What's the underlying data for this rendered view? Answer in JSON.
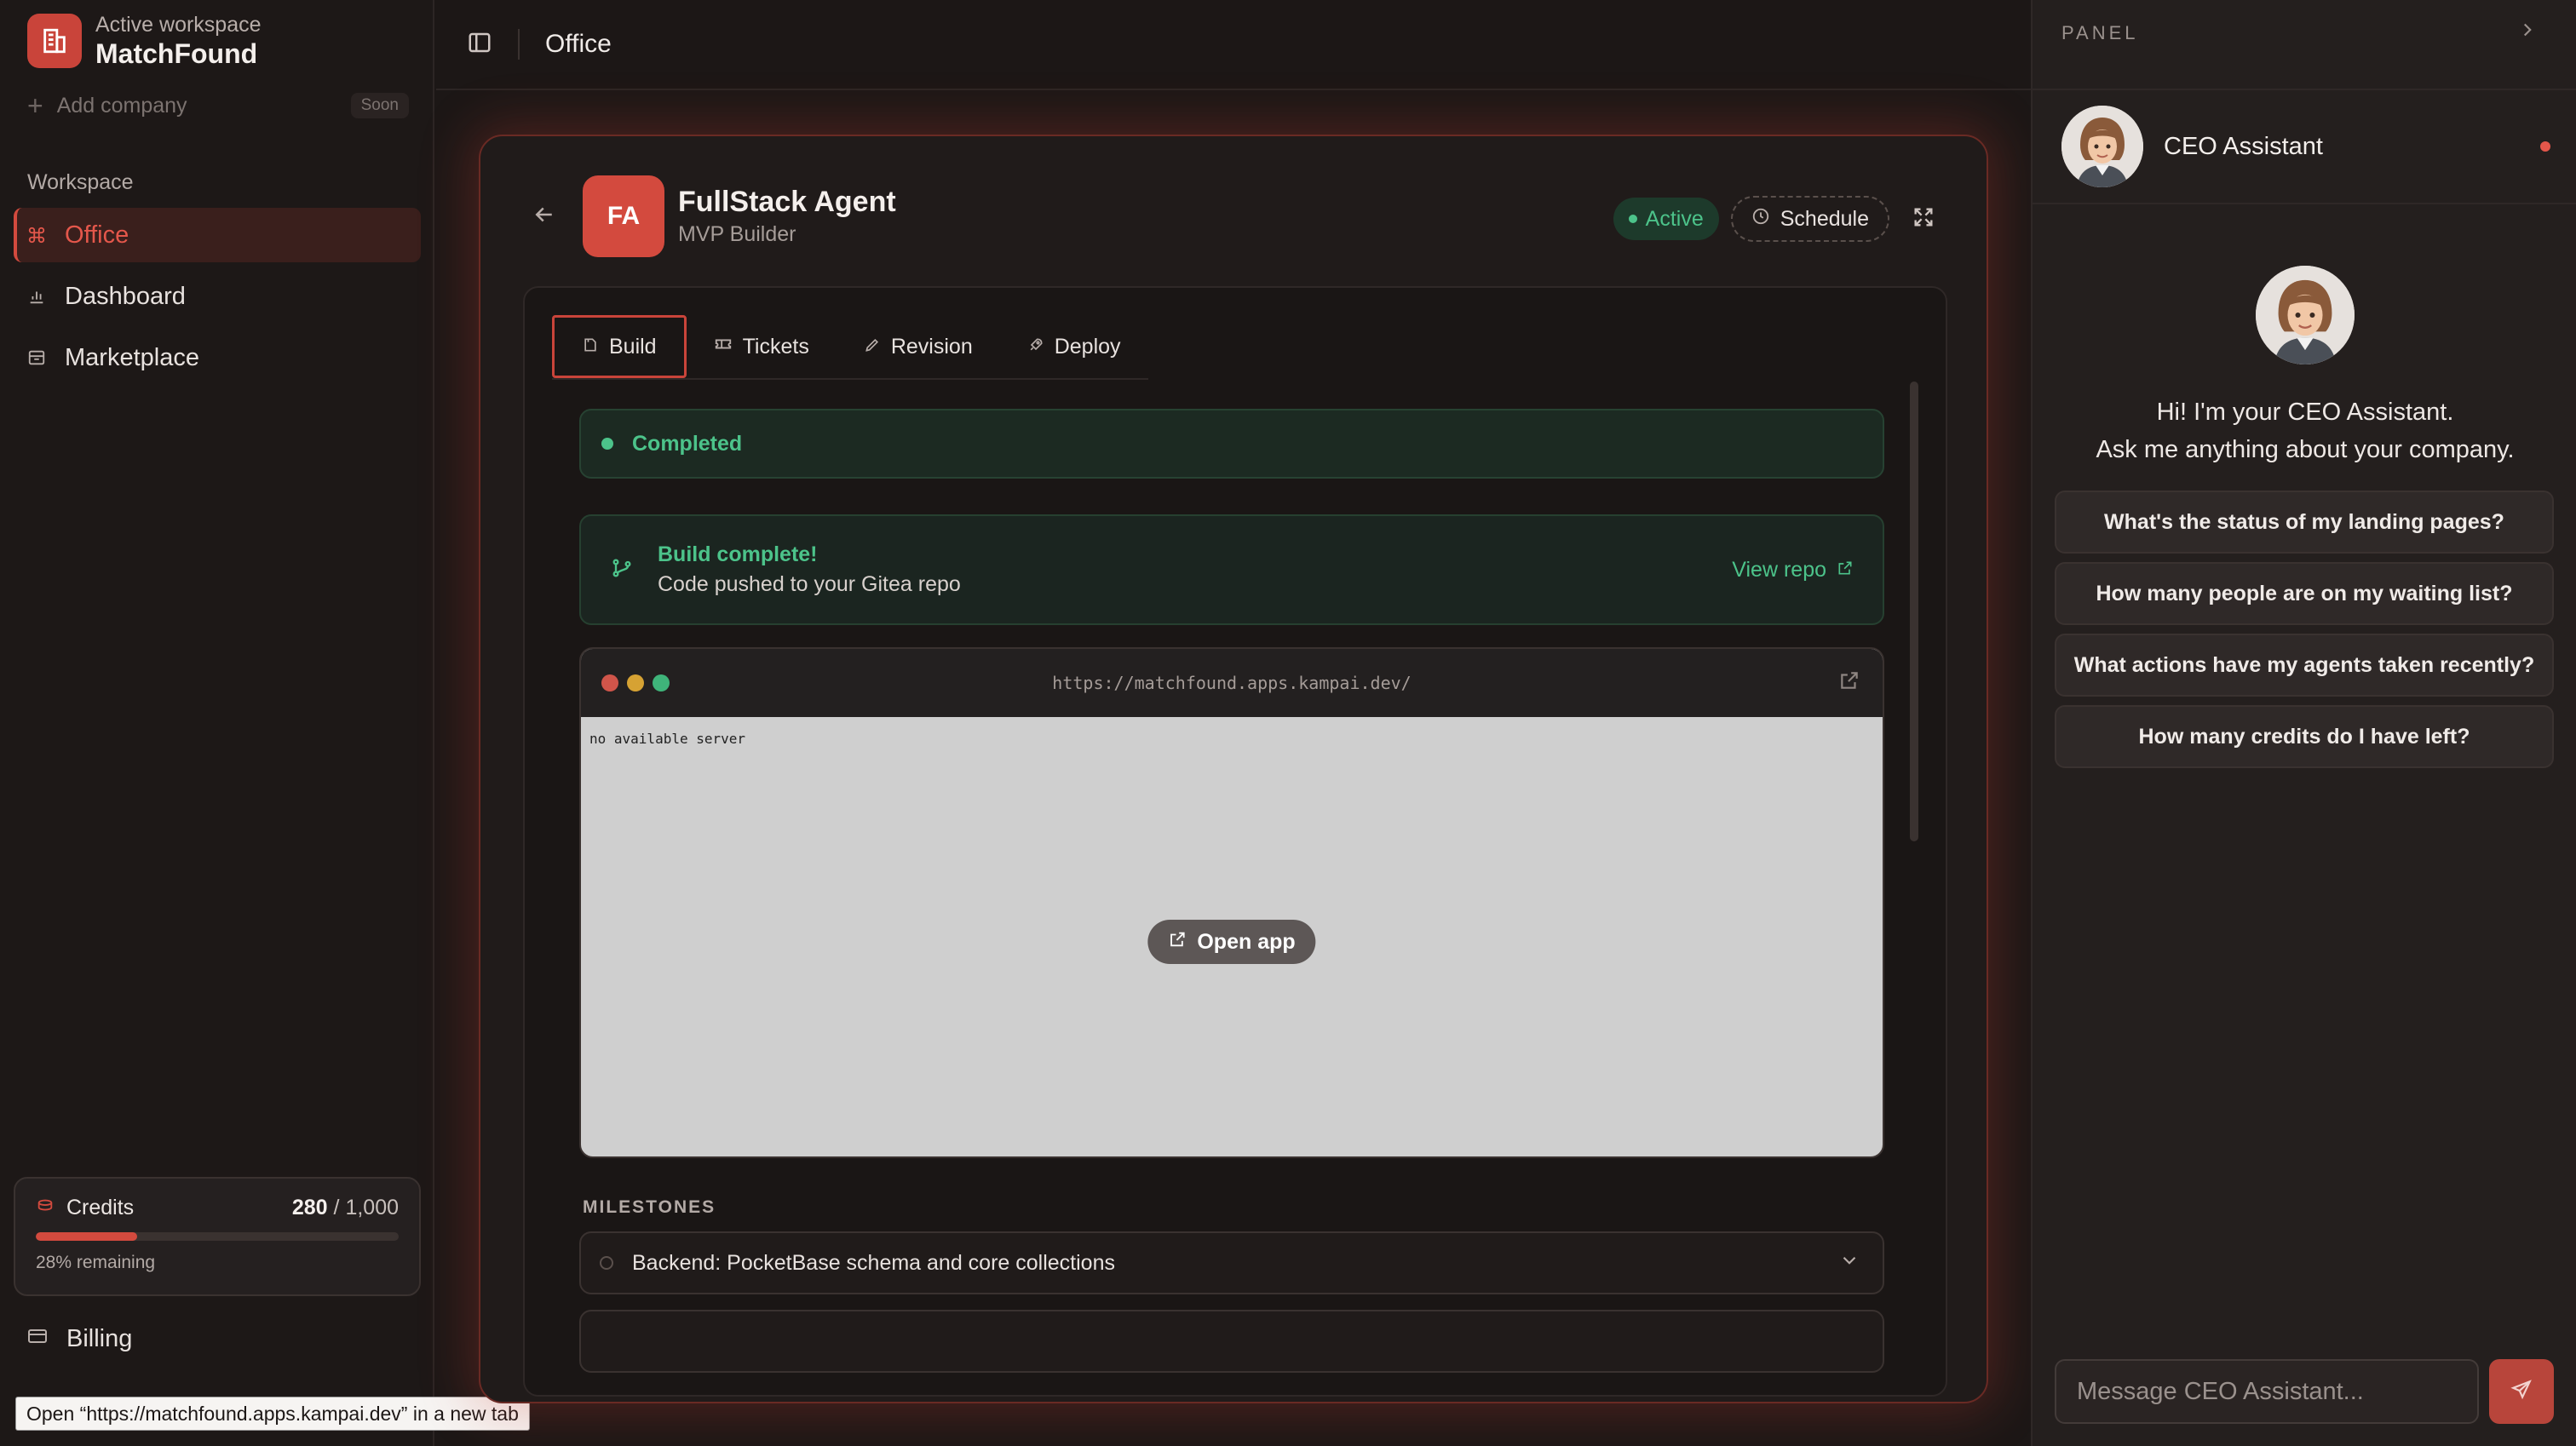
{
  "sidebar": {
    "workspace_label": "Active workspace",
    "workspace_name": "MatchFound",
    "add_company": "Add company",
    "soon_badge": "Soon",
    "section_label": "Workspace",
    "items": [
      {
        "label": "Office",
        "icon": "command-icon",
        "active": true
      },
      {
        "label": "Dashboard",
        "icon": "bar-chart-icon",
        "active": false
      },
      {
        "label": "Marketplace",
        "icon": "store-icon",
        "active": false
      }
    ],
    "credits": {
      "label": "Credits",
      "used": "280",
      "total": "/ 1,000",
      "remaining_fraction": 0.28,
      "remaining_text": "28% remaining"
    },
    "billing": "Billing"
  },
  "tooltip": "Open “https://matchfound.apps.kampai.dev” in a new tab",
  "topbar": {
    "title": "Office"
  },
  "agent": {
    "initials": "FA",
    "name": "FullStack Agent",
    "role": "MVP Builder",
    "status": "Active",
    "schedule": "Schedule",
    "tabs": [
      {
        "label": "Build",
        "icon": "hammer-icon",
        "active": true
      },
      {
        "label": "Tickets",
        "icon": "ticket-icon",
        "active": false
      },
      {
        "label": "Revision",
        "icon": "pencil-icon",
        "active": false
      },
      {
        "label": "Deploy",
        "icon": "rocket-icon",
        "active": false
      }
    ],
    "completed": "Completed",
    "build": {
      "title": "Build complete!",
      "subtitle": "Code pushed to your Gitea repo",
      "view_repo": "View repo"
    },
    "preview": {
      "url": "https://matchfound.apps.kampai.dev/",
      "content": "no available server",
      "open_app": "Open app"
    },
    "milestones_label": "MILESTONES",
    "milestones": [
      {
        "title": "Backend: PocketBase schema and core collections"
      }
    ]
  },
  "panel": {
    "label": "PANEL",
    "assistant_name": "CEO Assistant",
    "greeting_line1": "Hi! I'm your CEO Assistant.",
    "greeting_line2": "Ask me anything about your company.",
    "suggestions": [
      "What's the status of my landing pages?",
      "How many people are on my waiting list?",
      "What actions have my agents taken recently?",
      "How many credits do I have left?"
    ],
    "input_placeholder": "Message CEO Assistant..."
  },
  "colors": {
    "accent": "#d34a3e",
    "success": "#4cc38a",
    "background": "#1c1716"
  }
}
